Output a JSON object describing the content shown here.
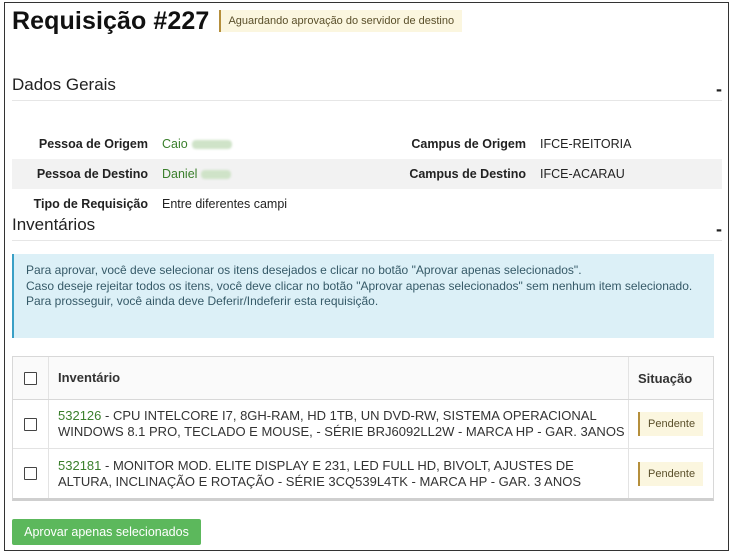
{
  "header": {
    "title": "Requisição #227",
    "status": "Aguardando aprovação do servidor de destino"
  },
  "dados_gerais": {
    "title": "Dados Gerais",
    "collapse_symbol": "-",
    "rows": [
      {
        "left_label": "Pessoa de Origem",
        "left_value": "Caio",
        "right_label": "Campus de Origem",
        "right_value": "IFCE-REITORIA"
      },
      {
        "left_label": "Pessoa de Destino",
        "left_value": "Daniel",
        "right_label": "Campus de Destino",
        "right_value": "IFCE-ACARAU"
      },
      {
        "left_label": "Tipo de Requisição",
        "left_value": "Entre diferentes campi"
      }
    ]
  },
  "inventarios": {
    "title": "Inventários",
    "collapse_symbol": "-",
    "alert": {
      "line1": "Para aprovar, você deve selecionar os itens desejados e clicar no botão \"Aprovar apenas selecionados\".",
      "line2": "Caso deseje rejeitar todos os itens, você deve clicar no botão \"Aprovar apenas selecionados\" sem nenhum item selecionado.",
      "line3": "Para prosseguir, você ainda deve Deferir/Indeferir esta requisição."
    },
    "table": {
      "col_inventario": "Inventário",
      "col_situacao": "Situação",
      "rows": [
        {
          "code": "532126",
          "description": " - CPU INTELCORE I7, 8GH-RAM, HD 1TB, UN DVD-RW, SISTEMA OPERACIONAL WINDOWS 8.1 PRO, TECLADO E MOUSE, - SÉRIE BRJ6092LL2W - MARCA HP - GAR. 3ANOS",
          "status": "Pendente"
        },
        {
          "code": "532181",
          "description": " - MONITOR MOD. ELITE DISPLAY E 231, LED FULL HD, BIVOLT, AJUSTES DE ALTURA, INCLINAÇÃO E ROTAÇÃO - SÉRIE 3CQ539L4TK - MARCA HP - GAR. 3 ANOS",
          "status": "Pendente"
        }
      ]
    },
    "approve_button": "Aprovar apenas selecionados"
  },
  "colors": {
    "link_green": "#3a7f2c",
    "button_green": "#5cb85c",
    "alert_bg": "#dcf0f7",
    "badge_bg": "#fbf6df"
  }
}
